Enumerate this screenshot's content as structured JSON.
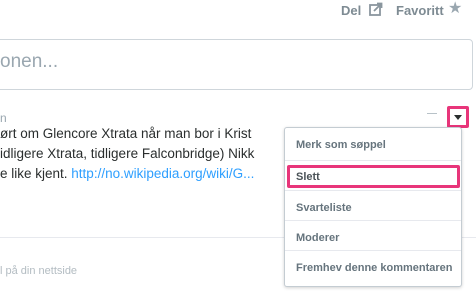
{
  "header": {
    "share_label": "Del",
    "favorite_label": "Favoritt",
    "share_icon": "share-icon",
    "favorite_icon": "star-icon"
  },
  "composer": {
    "placeholder": "onen..."
  },
  "comment": {
    "meta_fragment": "n",
    "line1": "ørt om Glencore Xtrata når man bor i Krist",
    "line2": "idligere Xtrata, tidligere Falconbridge) Nikk",
    "line3_text": "e like kjent. ",
    "line3_link": "http://no.wikipedia.org/wiki/G..."
  },
  "footer": {
    "fragment": "l på din nettside"
  },
  "menu": {
    "items": [
      {
        "label": "Merk som søppel"
      },
      {
        "label": "Slett"
      },
      {
        "label": "Svarteliste"
      },
      {
        "label": "Moderer"
      },
      {
        "label": "Fremhev denne kommentaren"
      }
    ]
  },
  "colors": {
    "highlight": "#e8357a",
    "link": "#2e9fff"
  }
}
